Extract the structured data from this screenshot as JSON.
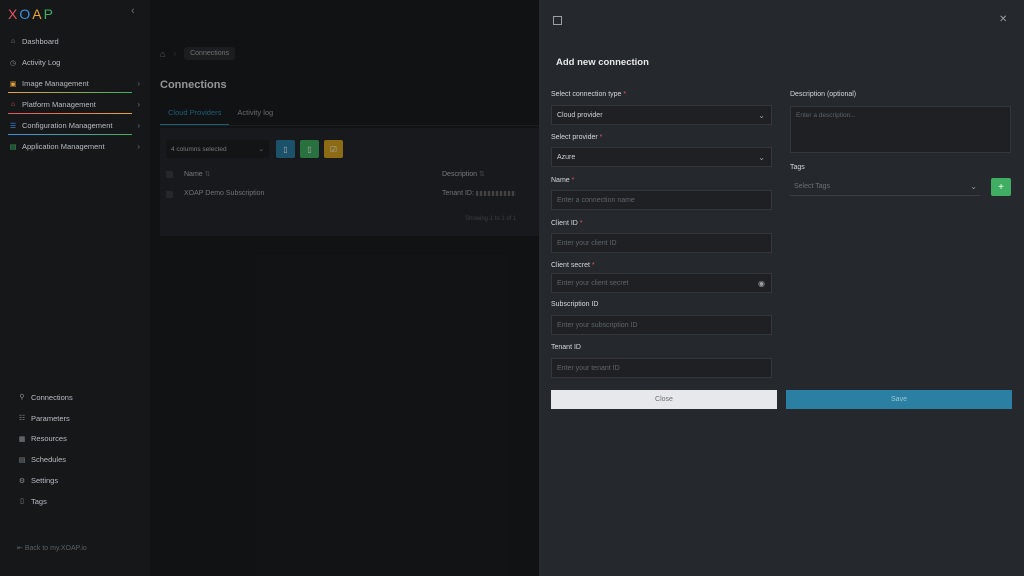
{
  "app": {
    "logo_text": "XOAP"
  },
  "sidebar": {
    "items": [
      {
        "label": "Dashboard",
        "icon": "home-icon"
      },
      {
        "label": "Activity Log",
        "icon": "clock-icon"
      },
      {
        "label": "Image Management",
        "icon": "image-icon",
        "accent": "#e8a33d"
      },
      {
        "label": "Platform Management",
        "icon": "platform-icon",
        "accent": "#e05561"
      },
      {
        "label": "Configuration Management",
        "icon": "config-icon",
        "accent": "#3d8fe0"
      },
      {
        "label": "Application Management",
        "icon": "app-icon",
        "accent": "#3fae62"
      }
    ],
    "bottom_items": [
      {
        "label": "Connections",
        "icon": "link-icon"
      },
      {
        "label": "Parameters",
        "icon": "list-icon"
      },
      {
        "label": "Resources",
        "icon": "resources-icon"
      },
      {
        "label": "Schedules",
        "icon": "calendar-icon"
      },
      {
        "label": "Settings",
        "icon": "gear-icon"
      },
      {
        "label": "Tags",
        "icon": "tag-icon"
      }
    ],
    "back_link": "Back to my.XOAP.io"
  },
  "main": {
    "breadcrumb": "Connections",
    "title": "Connections",
    "tabs": [
      {
        "label": "Cloud Providers",
        "active": true
      },
      {
        "label": "Activity log",
        "active": false
      }
    ],
    "columns_select": "4 columns selected",
    "table": {
      "headers": [
        "Name",
        "Description"
      ],
      "rows": [
        {
          "name": "XOAP Demo Subscription",
          "description": "Tenant ID:"
        }
      ]
    },
    "showing": "Showing 1 to 1 of 1"
  },
  "modal": {
    "title": "Add new connection",
    "fields": {
      "connection_type": {
        "label": "Select connection type",
        "value": "Cloud provider"
      },
      "provider": {
        "label": "Select provider",
        "value": "Azure"
      },
      "name": {
        "label": "Name",
        "placeholder": "Enter a connection name"
      },
      "client_id": {
        "label": "Client ID",
        "placeholder": "Enter your client ID"
      },
      "client_secret": {
        "label": "Client secret",
        "placeholder": "Enter your client secret"
      },
      "subscription_id": {
        "label": "Subscription ID",
        "placeholder": "Enter your subscription ID"
      },
      "tenant_id": {
        "label": "Tenant ID",
        "placeholder": "Enter your tenant ID"
      },
      "description": {
        "label": "Description (optional)",
        "placeholder": "Enter a description..."
      },
      "tags": {
        "label": "Tags",
        "placeholder": "Select Tags"
      }
    },
    "close_label": "Close",
    "save_label": "Save"
  },
  "colors": {
    "accent_blue": "#2a7fa2",
    "green": "#3fae62",
    "yellow": "#d9a520",
    "required": "#e05561"
  }
}
